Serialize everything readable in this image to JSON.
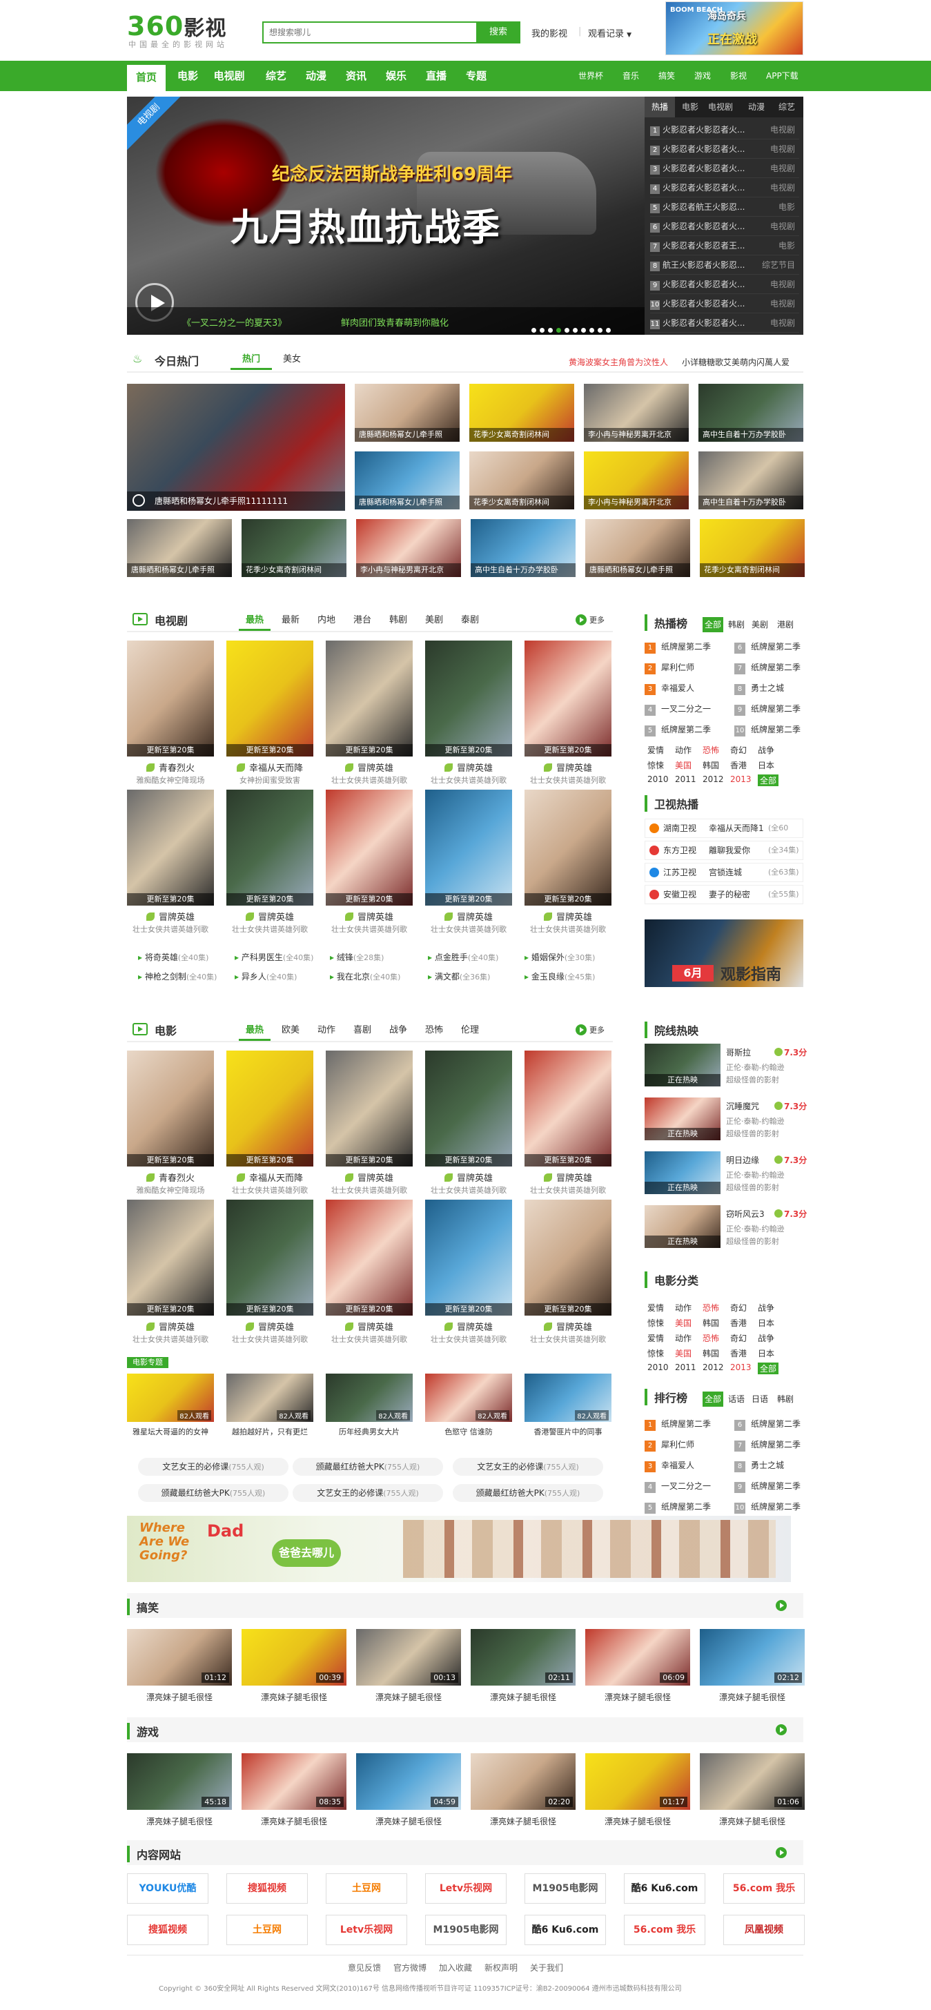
{
  "header": {
    "logo_num": "360",
    "logo_text": "影视",
    "slogan": "中国最全的影视网站",
    "search_placeholder": "想搜索哪儿",
    "search_button": "搜索",
    "my_video": "我的影视",
    "watch_history": "观看记录",
    "ad_text_1": "海岛奇兵",
    "ad_text_2": "正在激战",
    "ad_text_3": "BOOM BEACH"
  },
  "nav": {
    "items": [
      "首页",
      "电影",
      "电视剧",
      "综艺",
      "动漫",
      "资讯",
      "娱乐",
      "直播",
      "专题"
    ],
    "right_items": [
      "世界杯",
      "音乐",
      "搞笑",
      "游戏",
      "影视",
      "APP下载"
    ]
  },
  "banner": {
    "corner": "电视剧",
    "line1": "纪念反法西斯战争胜利69周年",
    "line2": "九月热血抗战季",
    "cap_left": "《一叉二分之一的夏天3》",
    "cap_right": "鲜肉团们致青春萌到你融化"
  },
  "hot": {
    "tabs": [
      "热播",
      "电影",
      "电视剧",
      "动漫",
      "综艺"
    ],
    "rows": [
      {
        "n": "1",
        "t": "火影忍者火影忍者火...",
        "c": "电视剧"
      },
      {
        "n": "2",
        "t": "火影忍者火影忍者火...",
        "c": "电视剧"
      },
      {
        "n": "3",
        "t": "火影忍者火影忍者火...",
        "c": "电视剧"
      },
      {
        "n": "4",
        "t": "火影忍者火影忍者火...",
        "c": "电视剧"
      },
      {
        "n": "5",
        "t": "火影忍者航王火影忍...",
        "c": "电影"
      },
      {
        "n": "6",
        "t": "火影忍者火影忍者火...",
        "c": "电视剧"
      },
      {
        "n": "7",
        "t": "火影忍者火影忍者王...",
        "c": "电影"
      },
      {
        "n": "8",
        "t": "航王火影忍者火影忍...",
        "c": "综艺节目"
      },
      {
        "n": "9",
        "t": "火影忍者火影忍者火...",
        "c": "电视剧"
      },
      {
        "n": "10",
        "t": "火影忍者火影忍者火...",
        "c": "电视剧"
      },
      {
        "n": "11",
        "t": "火影忍者火影忍者火...",
        "c": "电视剧"
      },
      {
        "n": "12",
        "t": "火影忍者火影忍者火...",
        "c": "电视剧"
      }
    ]
  },
  "today": {
    "title": "今日热门",
    "tabs": [
      "热门",
      "美女"
    ],
    "news1": "黄海波案女主角曾为汶性人",
    "news2": "小详糖糖歌艾美萌内闪萬人爱",
    "big_caption": "唐縣晒和杨幂女儿牵手照11111111",
    "grid": [
      "唐縣晒和杨幂女儿牵手照",
      "花季少女离奇割闭林间",
      "李小冉与神秘男离开北京",
      "高中生自着十万办学胶卧",
      "唐縣晒和杨幂女儿牵手照",
      "花季少女离奇割闭林间",
      "李小冉与神秘男离开北京",
      "高中生自着十万办学胶卧",
      "唐縣晒和杨幂女儿牵手照",
      "花季少女离奇割闭林间",
      "李小冉与神秘男离开北京",
      "高中生自着十万办学胶卧",
      "唐縣晒和杨幂女儿牵手照",
      "花季少女离奇割闭林间"
    ]
  },
  "tv": {
    "title": "电视剧",
    "tabs": [
      "最热",
      "最新",
      "内地",
      "港台",
      "韩剧",
      "美剧",
      "泰剧"
    ],
    "more": "更多",
    "bar": "更新至第20集",
    "row1": [
      {
        "t": "青春烈火",
        "d": "雅痴酷女神空降现场"
      },
      {
        "t": "幸福从天而降",
        "d": "女神扮闺蜜受致害"
      },
      {
        "t": "冒牌英雄",
        "d": "壮士女侠共谱英雄列歌"
      },
      {
        "t": "冒牌英雄",
        "d": "壮士女侠共谱英雄列歌"
      },
      {
        "t": "冒牌英雄",
        "d": "壮士女侠共谱英雄列歌"
      }
    ],
    "row2": [
      {
        "t": "冒牌英雄",
        "d": "壮士女侠共谱英雄列歌"
      },
      {
        "t": "冒牌英雄",
        "d": "壮士女侠共谱英雄列歌"
      },
      {
        "t": "冒牌英雄",
        "d": "壮士女侠共谱英雄列歌"
      },
      {
        "t": "冒牌英雄",
        "d": "壮士女侠共谱英雄列歌"
      },
      {
        "t": "冒牌英雄",
        "d": "壮士女侠共谱英雄列歌"
      }
    ],
    "links": [
      {
        "t": "将奇英雄",
        "n": "(全40集)"
      },
      {
        "t": "产科男医生",
        "n": "(全40集)"
      },
      {
        "t": "绒锋",
        "n": "(全28集)"
      },
      {
        "t": "点金胜手",
        "n": "(全40集)"
      },
      {
        "t": "婚姻保外",
        "n": "(全30集)"
      },
      {
        "t": "神枪之剑制",
        "n": "(全40集)"
      },
      {
        "t": "异乡人",
        "n": "(全40集)"
      },
      {
        "t": "我在北京",
        "n": "(全40集)"
      },
      {
        "t": "满文都",
        "n": "(全36集)"
      },
      {
        "t": "金玉良缘",
        "n": "(全45集)"
      }
    ]
  },
  "rank1": {
    "title": "热播榜",
    "tabs": [
      "全部",
      "韩剧",
      "美剧",
      "港剧"
    ],
    "rows": [
      {
        "n": "1",
        "t": "纸牌屋第二季"
      },
      {
        "n": "6",
        "t": "纸牌屋第二季"
      },
      {
        "n": "2",
        "t": "犀利仁师"
      },
      {
        "n": "7",
        "t": "纸牌屋第二季"
      },
      {
        "n": "3",
        "t": "幸福爱人"
      },
      {
        "n": "8",
        "t": "勇士之城"
      },
      {
        "n": "4",
        "t": "一叉二分之一"
      },
      {
        "n": "9",
        "t": "纸牌屋第二季"
      },
      {
        "n": "5",
        "t": "纸牌屋第二季"
      },
      {
        "n": "10",
        "t": "纸牌屋第二季"
      }
    ],
    "classes": [
      "爱情",
      "动作",
      "恐怖",
      "奇幻",
      "战争",
      "惊悚",
      "美国",
      "韩国",
      "香港",
      "日本",
      "2010",
      "2011",
      "2012",
      "2013",
      "全部"
    ]
  },
  "satellite": {
    "title": "卫视热播",
    "rows": [
      {
        "ch": "湖南卫视",
        "p": "幸福从天而降1",
        "n": "(全60"
      },
      {
        "ch": "东方卫视",
        "p": "離聊我爱你",
        "n": "(全34集)"
      },
      {
        "ch": "江苏卫视",
        "p": "宫锁连城",
        "n": "(全63集)"
      },
      {
        "ch": "安徽卫视",
        "p": "妻子的秘密",
        "n": "(全55集)"
      }
    ],
    "ad_month": "6月",
    "ad_text": "观影指南"
  },
  "movie": {
    "title": "电影",
    "tabs": [
      "最热",
      "欧美",
      "动作",
      "喜剧",
      "战争",
      "恐怖",
      "伦理"
    ],
    "more": "更多",
    "bar": "更新至第20集",
    "row1": [
      {
        "t": "青春烈火",
        "d": "雅痴酷女神空降现场"
      },
      {
        "t": "幸福从天而降",
        "d": "壮士女侠共谱英雄列歌"
      },
      {
        "t": "冒牌英雄",
        "d": "壮士女侠共谱英雄列歌"
      },
      {
        "t": "冒牌英雄",
        "d": "壮士女侠共谱英雄列歌"
      },
      {
        "t": "冒牌英雄",
        "d": "壮士女侠共谱英雄列歌"
      }
    ],
    "row2": [
      {
        "t": "冒牌英雄",
        "d": "壮士女侠共谱英雄列歌"
      },
      {
        "t": "冒牌英雄",
        "d": "壮士女侠共谱英雄列歌"
      },
      {
        "t": "冒牌英雄",
        "d": "壮士女侠共谱英雄列歌"
      },
      {
        "t": "冒牌英雄",
        "d": "壮士女侠共谱英雄列歌"
      },
      {
        "t": "冒牌英雄",
        "d": "壮士女侠共谱英雄列歌"
      }
    ],
    "special_tag": "电影专题",
    "specials": [
      {
        "t": "雅星坛大哥逼的的女神",
        "c": "82人观看"
      },
      {
        "t": "越拍越好片，只有更烂",
        "c": "82人观看"
      },
      {
        "t": "历年经典男女大片",
        "c": "82人观看"
      },
      {
        "t": "色慾守 信谁防",
        "c": "82人观看"
      },
      {
        "t": "香港警匪片中的同事",
        "c": "82人观看"
      }
    ],
    "pills": [
      {
        "t": "文艺女王的必修课",
        "n": "(755人观)"
      },
      {
        "t": "颁藏最红纺爸大PK",
        "n": "(755人观)"
      },
      {
        "t": "文艺女王的必修课",
        "n": "(755人观)"
      },
      {
        "t": "颁藏最红纺爸大PK",
        "n": "(755人观)"
      },
      {
        "t": "文艺女王的必修课",
        "n": "(755人观)"
      },
      {
        "t": "颁藏最红纺爸大PK",
        "n": "(755人观)"
      }
    ]
  },
  "cinema": {
    "title": "院线热映",
    "rows": [
      {
        "t": "哥斯拉",
        "s": "7.3分",
        "d1": "正伦·泰勒-约翰逊",
        "d2": "超级怪兽的影射"
      },
      {
        "t": "沉睡魔咒",
        "s": "7.3分",
        "d1": "正伦·泰勒-约翰逊",
        "d2": "超级怪兽的影射"
      },
      {
        "t": "明日边缘",
        "s": "7.3分",
        "d1": "正伦·泰勒-约翰逊",
        "d2": "超级怪兽的影射"
      },
      {
        "t": "窃听风云3",
        "s": "7.3分",
        "d1": "正伦·泰勒-约翰逊",
        "d2": "超级怪兽的影射"
      }
    ],
    "badge": "正在热映"
  },
  "moviecls": {
    "title": "电影分类",
    "rows": [
      [
        "爱情",
        "动作",
        "恐怖",
        "奇幻",
        "战争"
      ],
      [
        "惊悚",
        "美国",
        "韩国",
        "香港",
        "日本"
      ],
      [
        "爱情",
        "动作",
        "恐怖",
        "奇幻",
        "战争"
      ],
      [
        "惊悚",
        "美国",
        "韩国",
        "香港",
        "日本"
      ],
      [
        "2010",
        "2011",
        "2012",
        "2013",
        "全部"
      ]
    ]
  },
  "rank2": {
    "title": "排行榜",
    "tabs": [
      "全部",
      "话语",
      "日语",
      "韩剧"
    ],
    "rows": [
      {
        "n": "1",
        "t": "纸牌屋第二季"
      },
      {
        "n": "6",
        "t": "纸牌屋第二季"
      },
      {
        "n": "2",
        "t": "犀利仁师"
      },
      {
        "n": "7",
        "t": "纸牌屋第二季"
      },
      {
        "n": "3",
        "t": "幸福爱人"
      },
      {
        "n": "8",
        "t": "勇士之城"
      },
      {
        "n": "4",
        "t": "一叉二分之一"
      },
      {
        "n": "9",
        "t": "纸牌屋第二季"
      },
      {
        "n": "5",
        "t": "纸牌屋第二季"
      },
      {
        "n": "10",
        "t": "纸牌屋第二季"
      }
    ]
  },
  "promo": {
    "t1": "Where Are We Going?",
    "t2": "Dad",
    "t3": "爸爸去哪儿"
  },
  "funny": {
    "title": "搞笑",
    "items": [
      {
        "t": "漂亮妹子腿毛很怪",
        "d": "01:12"
      },
      {
        "t": "漂亮妹子腿毛很怪",
        "d": "00:39"
      },
      {
        "t": "漂亮妹子腿毛很怪",
        "d": "00:13"
      },
      {
        "t": "漂亮妹子腿毛很怪",
        "d": "02:11"
      },
      {
        "t": "漂亮妹子腿毛很怪",
        "d": "06:09"
      },
      {
        "t": "漂亮妹子腿毛很怪",
        "d": "02:12"
      }
    ]
  },
  "games": {
    "title": "游戏",
    "items": [
      {
        "t": "漂亮妹子腿毛很怪",
        "d": "45:18"
      },
      {
        "t": "漂亮妹子腿毛很怪",
        "d": "08:35"
      },
      {
        "t": "漂亮妹子腿毛很怪",
        "d": "04:59"
      },
      {
        "t": "漂亮妹子腿毛很怪",
        "d": "02:20"
      },
      {
        "t": "漂亮妹子腿毛很怪",
        "d": "01:17"
      },
      {
        "t": "漂亮妹子腿毛很怪",
        "d": "01:06"
      }
    ]
  },
  "partners": {
    "title": "内容网站",
    "row1": [
      {
        "t": "YOUKU优酷",
        "c": "#1e88e5"
      },
      {
        "t": "搜狐视频",
        "c": "#e53935"
      },
      {
        "t": "土豆网",
        "c": "#f57c00"
      },
      {
        "t": "Letv乐视网",
        "c": "#e53935"
      },
      {
        "t": "M1905电影网",
        "c": "#555"
      },
      {
        "t": "酷6 Ku6.com",
        "c": "#222"
      },
      {
        "t": "56.com 我乐",
        "c": "#e53935"
      }
    ],
    "row2": [
      {
        "t": "搜狐视频",
        "c": "#e53935"
      },
      {
        "t": "土豆网",
        "c": "#f57c00"
      },
      {
        "t": "Letv乐视网",
        "c": "#e53935"
      },
      {
        "t": "M1905电影网",
        "c": "#555"
      },
      {
        "t": "酷6 Ku6.com",
        "c": "#222"
      },
      {
        "t": "56.com 我乐",
        "c": "#e53935"
      },
      {
        "t": "凤凰视频",
        "c": "#c62828"
      }
    ]
  },
  "footer": {
    "links": [
      "意见反馈",
      "官方微博",
      "加入收藏",
      "新权声明",
      "关于我们"
    ],
    "copyright": "Copyright © 360安全网址  All Rights Reserved  文网文(2010)167号  信息网络传播视听节目许可证 1109357ICP证号：渝B2-20090064  遵州市迅城数码科技有限公司"
  }
}
